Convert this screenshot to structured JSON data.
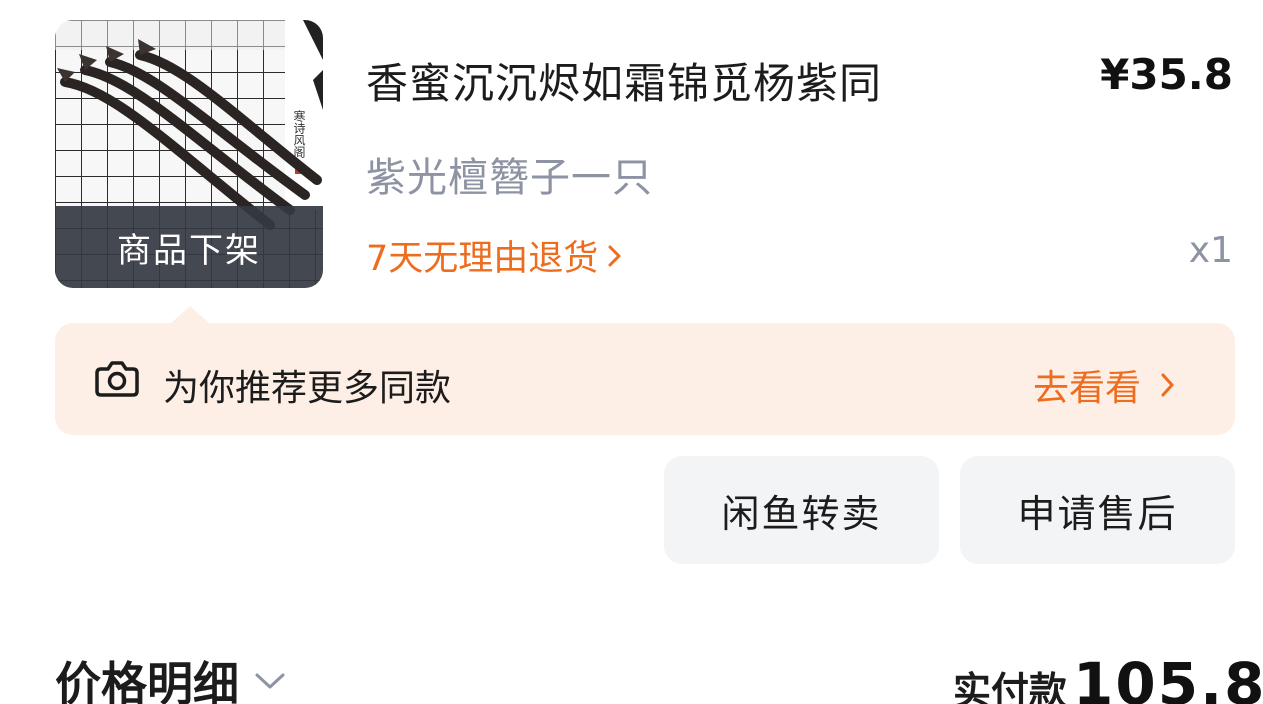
{
  "product": {
    "title": "香蜜沉沉烬如霜锦觅杨紫同",
    "price": "¥35.8",
    "spec": "紫光檀簪子一只",
    "return_policy": "7天无理由退货",
    "quantity": "x1",
    "status_overlay": "商品下架",
    "image_alt": "hairpin-product-photo"
  },
  "recommend": {
    "icon": "camera-icon",
    "text": "为你推荐更多同款",
    "action": "去看看"
  },
  "buttons": {
    "resell": "闲鱼转卖",
    "after_sale": "申请售后"
  },
  "summary": {
    "detail_label": "价格明细",
    "paid_label": "实付款",
    "paid_value": "105.8"
  },
  "colors": {
    "accent": "#ee6c1e",
    "banner_bg": "#fdefe6",
    "muted_text": "#8d93a3",
    "button_bg": "#f2f4f6"
  }
}
